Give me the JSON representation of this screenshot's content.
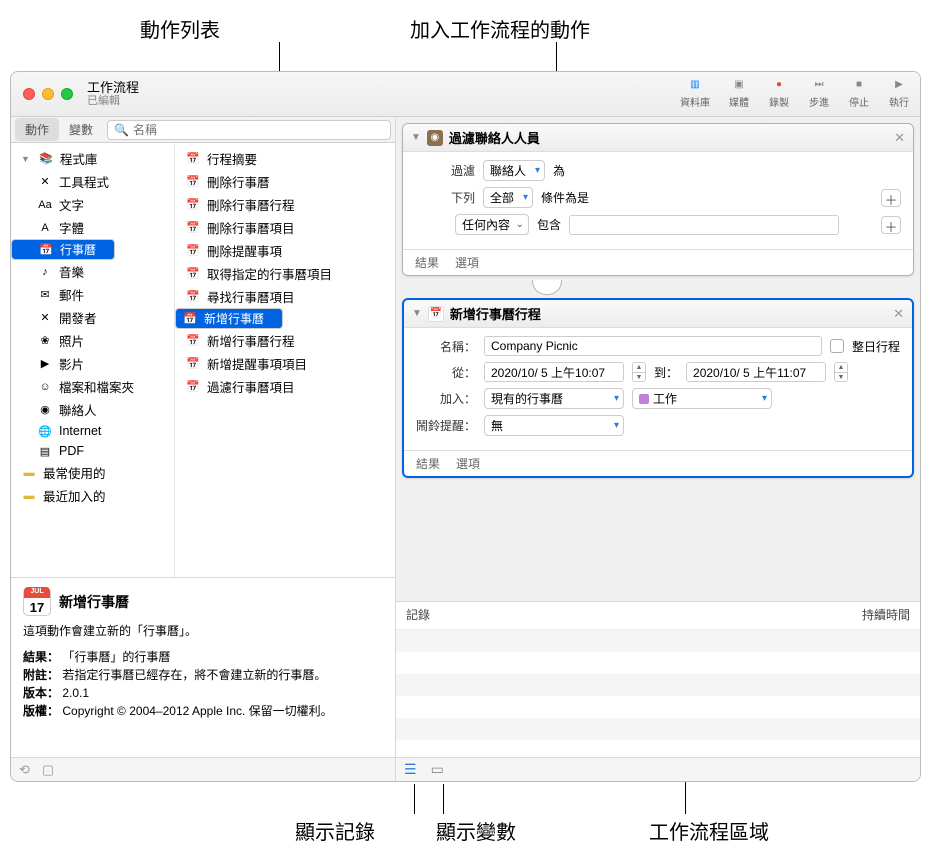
{
  "callouts": {
    "action_list": "動作列表",
    "added_actions": "加入工作流程的動作",
    "show_log": "顯示記錄",
    "show_vars": "顯示變數",
    "workflow_area": "工作流程區域"
  },
  "window": {
    "title": "工作流程",
    "subtitle": "已編輯"
  },
  "toolbar": [
    {
      "id": "library",
      "label": "資料庫"
    },
    {
      "id": "media",
      "label": "媒體"
    },
    {
      "id": "record",
      "label": "錄製"
    },
    {
      "id": "step",
      "label": "步進"
    },
    {
      "id": "stop",
      "label": "停止"
    },
    {
      "id": "run",
      "label": "執行"
    }
  ],
  "segments": {
    "actions": "動作",
    "variables": "變數"
  },
  "search_placeholder": "名稱",
  "library": [
    {
      "label": "程式庫",
      "icon": "📚",
      "indent": 0
    },
    {
      "label": "工具程式",
      "icon": "✕",
      "indent": 1
    },
    {
      "label": "文字",
      "icon": "Aa",
      "indent": 1
    },
    {
      "label": "字體",
      "icon": "A",
      "indent": 1
    },
    {
      "label": "行事曆",
      "icon": "📅",
      "indent": 1,
      "selected": true
    },
    {
      "label": "音樂",
      "icon": "♪",
      "indent": 1
    },
    {
      "label": "郵件",
      "icon": "✉",
      "indent": 1
    },
    {
      "label": "開發者",
      "icon": "✕",
      "indent": 1
    },
    {
      "label": "照片",
      "icon": "❀",
      "indent": 1
    },
    {
      "label": "影片",
      "icon": "▶",
      "indent": 1
    },
    {
      "label": "檔案和檔案夾",
      "icon": "☺",
      "indent": 1
    },
    {
      "label": "聯絡人",
      "icon": "◉",
      "indent": 1
    },
    {
      "label": "Internet",
      "icon": "🌐",
      "indent": 1
    },
    {
      "label": "PDF",
      "icon": "▤",
      "indent": 1
    },
    {
      "label": "最常使用的",
      "icon": "▬",
      "indent": 0,
      "color": "#e0b838"
    },
    {
      "label": "最近加入的",
      "icon": "▬",
      "indent": 0,
      "color": "#e0b838"
    }
  ],
  "actions": [
    {
      "label": "行程摘要"
    },
    {
      "label": "刪除行事曆"
    },
    {
      "label": "刪除行事曆行程"
    },
    {
      "label": "刪除行事曆項目"
    },
    {
      "label": "刪除提醒事項"
    },
    {
      "label": "取得指定的行事曆項目"
    },
    {
      "label": "尋找行事曆項目"
    },
    {
      "label": "新增行事曆",
      "selected": true
    },
    {
      "label": "新增行事曆行程"
    },
    {
      "label": "新增提醒事項項目"
    },
    {
      "label": "過濾行事曆項目"
    }
  ],
  "description": {
    "title": "新增行事曆",
    "summary": "這項動作會建立新的「行事曆」。",
    "result_lbl": "結果：",
    "result_val": "「行事曆」的行事曆",
    "note_lbl": "附註：",
    "note_val": "若指定行事曆已經存在，將不會建立新的行事曆。",
    "version_lbl": "版本：",
    "version_val": "2.0.1",
    "copyright_lbl": "版權：",
    "copyright_val": "Copyright © 2004–2012 Apple Inc. 保留一切權利。"
  },
  "wf1": {
    "title": "過濾聯絡人人員",
    "filter_lbl": "過濾",
    "filter_sel": "聯絡人",
    "filter_suffix": "為",
    "below_lbl": "下列",
    "below_sel": "全部",
    "below_suffix": "條件為是",
    "cond_sel": "任何內容",
    "cond_op": "包含",
    "results": "結果",
    "options": "選項"
  },
  "wf2": {
    "title": "新增行事曆行程",
    "name_lbl": "名稱：",
    "name_val": "Company Picnic",
    "allday": "整日行程",
    "from_lbl": "從：",
    "from_val": "2020/10/ 5 上午10:07",
    "to_lbl": "到：",
    "to_val": "2020/10/ 5 上午11:07",
    "addto_lbl": "加入：",
    "addto_sel": "現有的行事曆",
    "cal_sel": "工作",
    "alarm_lbl": "鬧鈴提醒：",
    "alarm_sel": "無",
    "results": "結果",
    "options": "選項"
  },
  "log": {
    "col1": "記錄",
    "col2": "持續時間"
  }
}
